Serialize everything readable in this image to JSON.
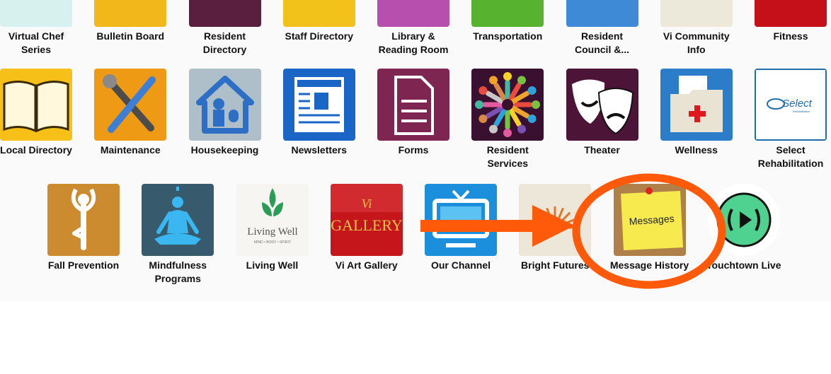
{
  "row1": [
    {
      "label": "Virtual Chef\nSeries",
      "icon": "video-icon",
      "color": "#d7f1ef"
    },
    {
      "label": "Bulletin Board",
      "icon": "bulletin-icon",
      "color": "#f2b81b"
    },
    {
      "label": "Resident\nDirectory",
      "icon": "resident-directory-icon",
      "color": "#5a1f3f"
    },
    {
      "label": "Staff Directory",
      "icon": "staff-directory-icon",
      "color": "#f3c21a"
    },
    {
      "label": "Library &\nReading Room",
      "icon": "book-icon",
      "color": "#b64fae"
    },
    {
      "label": "Transportation",
      "icon": "bus-icon",
      "color": "#56b22f"
    },
    {
      "label": "Resident\nCouncil &...",
      "icon": "council-icon",
      "color": "#e05a84"
    },
    {
      "label": "Vi Community\nInfo",
      "icon": "folder-icon",
      "color": "#ece9da"
    },
    {
      "label": "Fitness",
      "icon": "running-icon",
      "color": "#c5101a"
    }
  ],
  "row2": [
    {
      "label": "Local Directory",
      "icon": "open-book-icon",
      "color": "#f7c018"
    },
    {
      "label": "Maintenance",
      "icon": "tools-icon",
      "color": "#ee9a15"
    },
    {
      "label": "Housekeeping",
      "icon": "house-icon",
      "color": "#aebfc9"
    },
    {
      "label": "Newsletters",
      "icon": "newspaper-icon",
      "color": "#1a66c7"
    },
    {
      "label": "Forms",
      "icon": "document-icon",
      "color": "#7f2552"
    },
    {
      "label": "Resident\nServices",
      "icon": "people-circle-icon",
      "color": "#3a1030"
    },
    {
      "label": "Theater",
      "icon": "masks-icon",
      "color": "#4c1436"
    },
    {
      "label": "Wellness",
      "icon": "medical-folder-icon",
      "color": "#2b7dc9"
    },
    {
      "label": "Select\nRehabilitation",
      "icon": "select-logo-icon",
      "color": "#ffffff",
      "logo_text": "Select",
      "logo_sub": "Rehabilitation"
    }
  ],
  "row3": [
    {
      "label": "Fall Prevention",
      "icon": "tree-pose-icon",
      "color": "#cd8b30"
    },
    {
      "label": "Mindfulness\nPrograms",
      "icon": "meditation-icon",
      "color": "#375a6c"
    },
    {
      "label": "Living Well",
      "icon": "living-well-logo-icon",
      "color": "#f6f5f1",
      "logo_text": "Living Well",
      "logo_sub": "MIND • BODY • SPIRIT"
    },
    {
      "label": "Vi Art Gallery",
      "icon": "gallery-logo-icon",
      "color": "#c5161c",
      "logo_text": "GALLERY"
    },
    {
      "label": "Our Channel",
      "icon": "tv-icon",
      "color": "#1c8fdc"
    },
    {
      "label": "Bright Futures",
      "icon": "sunrise-logo-icon",
      "color": "#ece7d8"
    },
    {
      "label": "Message History",
      "icon": "sticky-note-icon",
      "color": "#b5864e",
      "note_text": "Messages"
    },
    {
      "label": "Touchtown Live",
      "icon": "broadcast-icon",
      "color": "#4fd18f"
    }
  ],
  "annotation": {
    "arrow_color": "#ff5a0a",
    "ellipse_color": "#ff5a0a"
  }
}
